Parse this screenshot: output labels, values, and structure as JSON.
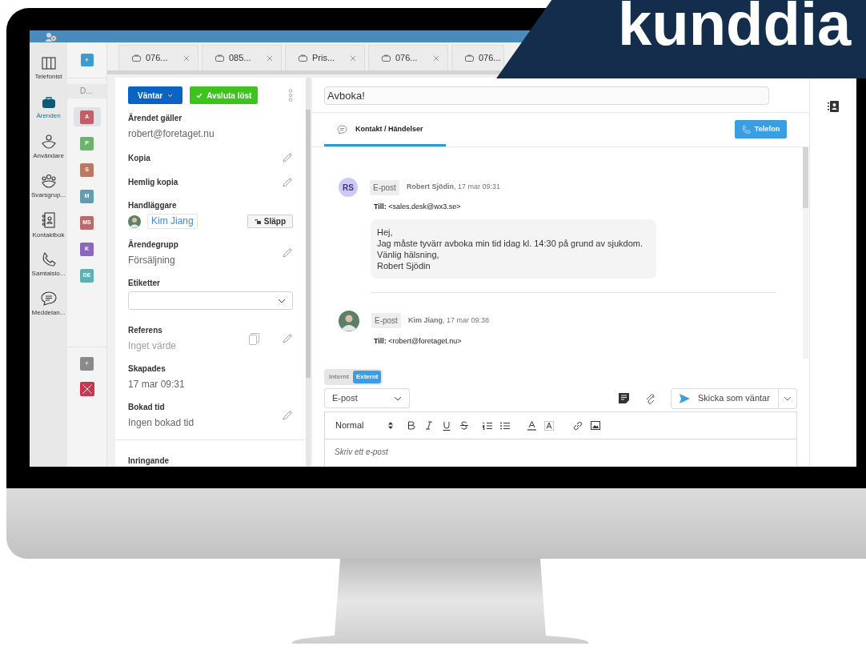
{
  "brand": {
    "text": "kunddia"
  },
  "nav": [
    {
      "label": "Telefonist",
      "selected": false
    },
    {
      "label": "Ärenden",
      "selected": true
    },
    {
      "label": "Användare",
      "selected": false
    },
    {
      "label": "Svarsgrup...",
      "selected": false
    },
    {
      "label": "Kontaktbok",
      "selected": false
    },
    {
      "label": "Samtalslo...",
      "selected": false
    },
    {
      "label": "Meddelan...",
      "selected": false
    }
  ],
  "queues": {
    "add_label": "+",
    "header": "D...",
    "items": [
      {
        "initials": "A",
        "color": "#bf5f68",
        "selected": true
      },
      {
        "initials": "P",
        "color": "#6db36b",
        "selected": false
      },
      {
        "initials": "S",
        "color": "#b97965",
        "selected": false
      },
      {
        "initials": "M",
        "color": "#5f9db3",
        "selected": false
      },
      {
        "initials": "MS",
        "color": "#b96a6a",
        "selected": false
      },
      {
        "initials": "K",
        "color": "#8d67bf",
        "selected": false
      },
      {
        "initials": "DE",
        "color": "#5eb0b3",
        "selected": false
      }
    ],
    "footer_add_label": "+"
  },
  "tabs": [
    {
      "label": "076...",
      "closable": true
    },
    {
      "label": "085...",
      "closable": true
    },
    {
      "label": "Pris...",
      "closable": true
    },
    {
      "label": "076...",
      "closable": true
    },
    {
      "label": "076...",
      "closable": false
    }
  ],
  "case_panel": {
    "status_button": "Väntar",
    "resolve_button": "Avsluta löst",
    "fields": [
      {
        "kind": "value",
        "label": "Ärendet gäller",
        "value": "robert@foretaget.nu"
      },
      {
        "kind": "editable",
        "label": "Kopia"
      },
      {
        "kind": "editable",
        "label": "Hemlig kopia"
      },
      {
        "kind": "handler",
        "label": "Handläggare",
        "value": "Kim Jiang",
        "button": "Släpp"
      },
      {
        "kind": "editable",
        "label": "Ärendegrupp",
        "value": "Försäljning"
      },
      {
        "kind": "select",
        "label": "Etiketter"
      },
      {
        "kind": "reference",
        "label": "Referens",
        "value": "Inget värde"
      },
      {
        "kind": "value",
        "label": "Skapades",
        "value": "17 mar 09:31"
      },
      {
        "kind": "editable",
        "label": "Bokad tid",
        "value": "Ingen bokad tid"
      },
      {
        "kind": "section",
        "label": "Inringande"
      }
    ]
  },
  "subject": "Avboka!",
  "conversation_tab": {
    "label": "Kontakt / Händelser",
    "selected": true
  },
  "phone_button": "Telefon",
  "messages": [
    {
      "avatar": {
        "kind": "initials",
        "text": "RS"
      },
      "channel": "E-post",
      "header": "**Robert Sjödin**, 17 mar 09:31",
      "to": "**Till:** <sales.desk@wx3.se>",
      "body": "Hej,\nJag måste tyvärr avboka min tid idag kl. 14:30 på grund av sjukdom.\nVänlig hälsning,\nRobert Sjödin"
    },
    {
      "avatar": {
        "kind": "photo"
      },
      "channel": "E-post",
      "header": "**Kim Jiang**, 17 mar 09:38",
      "to": "**Till:** <robert@foretaget.nu>"
    }
  ],
  "composer": {
    "visibility": [
      {
        "label": "Internt",
        "selected": false
      },
      {
        "label": "Externt",
        "selected": true
      }
    ],
    "channel": "E-post",
    "send_button": "Skicka som väntar",
    "format": "Normal",
    "placeholder": "Skriv ett e-post"
  }
}
